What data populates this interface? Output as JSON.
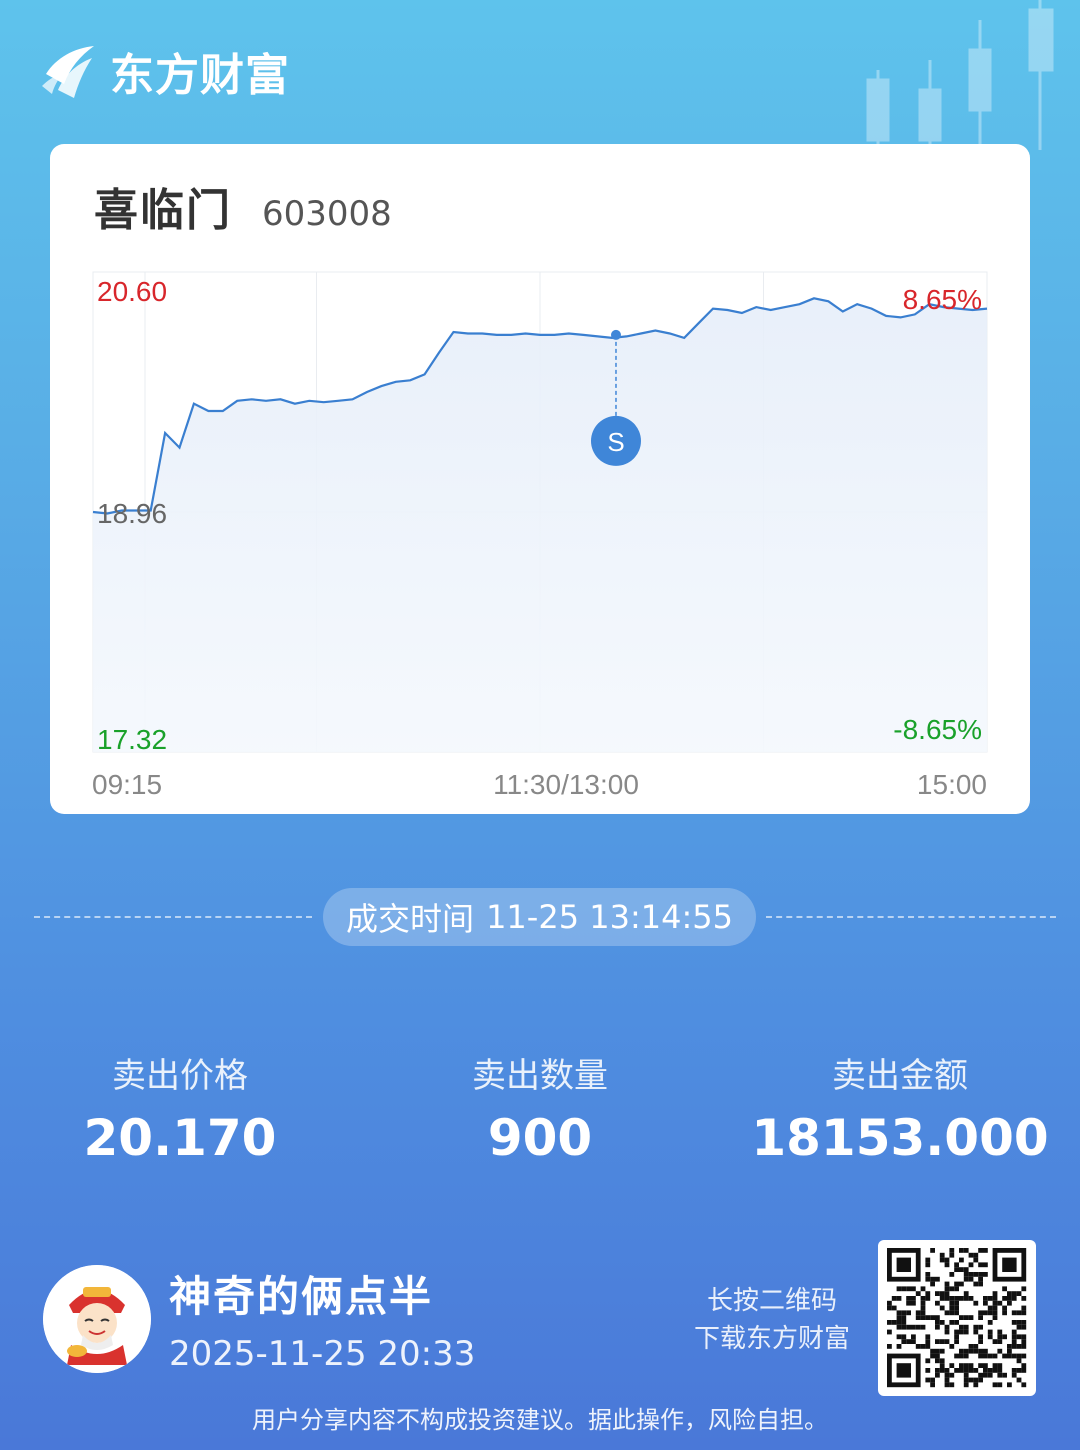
{
  "brand": {
    "name": "东方财富",
    "logo_icon": "eastmoney-logo-icon"
  },
  "stock": {
    "name": "喜临门",
    "code": "603008"
  },
  "chart_data": {
    "type": "line",
    "x_labels": [
      "09:15",
      "11:30/13:00",
      "15:00"
    ],
    "y_high_label": "20.60",
    "y_mid_label": "18.96",
    "y_low_label": "17.32",
    "pct_high_label": "8.65%",
    "pct_low_label": "-8.65%",
    "ylim": [
      17.32,
      20.6
    ],
    "prev_close": 18.96,
    "trade_marker": {
      "label": "S",
      "price": 20.17,
      "time": "13:14:55"
    },
    "series": [
      {
        "values": [
          18.96,
          18.95,
          18.97,
          18.97,
          18.97,
          19.5,
          19.4,
          19.7,
          19.65,
          19.65,
          19.72,
          19.73,
          19.72,
          19.73,
          19.7,
          19.72,
          19.71,
          19.72,
          19.73,
          19.78,
          19.82,
          19.85,
          19.86,
          19.9,
          20.05,
          20.19,
          20.18,
          20.18,
          20.17,
          20.17,
          20.18,
          20.17,
          20.17,
          20.18,
          20.17,
          20.16,
          20.15,
          20.16,
          20.18,
          20.2,
          20.18,
          20.15,
          20.25,
          20.35,
          20.34,
          20.32,
          20.36,
          20.34,
          20.36,
          20.38,
          20.42,
          20.4,
          20.33,
          20.38,
          20.35,
          20.3,
          20.29,
          20.31,
          20.38,
          20.36,
          20.35,
          20.34,
          20.35
        ],
        "color": "#3a7fd0"
      }
    ]
  },
  "trade": {
    "label": "成交时间",
    "time": "11-25 13:14:55"
  },
  "stats": [
    {
      "label": "卖出价格",
      "value": "20.170"
    },
    {
      "label": "卖出数量",
      "value": "900"
    },
    {
      "label": "卖出金额",
      "value": "18153.000"
    }
  ],
  "user": {
    "name": "神奇的俩点半",
    "time": "2025-11-25 20:33",
    "avatar_icon": "caishen-avatar-icon"
  },
  "qr": {
    "line1": "长按二维码",
    "line2": "下载东方财富",
    "icon": "qr-code-icon"
  },
  "disclaimer": "用户分享内容不构成投资建议。据此操作，风险自担。",
  "colors": {
    "up": "#d8262b",
    "down": "#1aa12a",
    "line": "#3a7fd0",
    "marker": "#3f86d8"
  }
}
